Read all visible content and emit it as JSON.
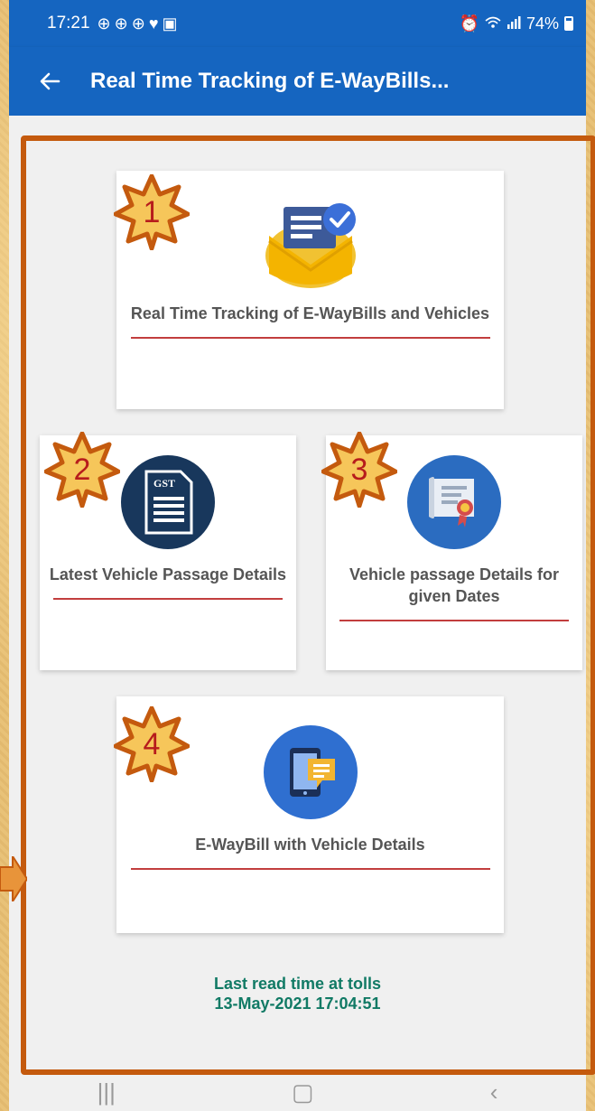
{
  "status_bar": {
    "time": "17:21",
    "battery": "74%",
    "icons": [
      "notification-icon",
      "notification-icon",
      "notification-icon",
      "heart-icon",
      "image-icon"
    ],
    "right_icons": [
      "alarm-icon",
      "wifi-icon",
      "signal-icon",
      "battery-icon"
    ]
  },
  "app_bar": {
    "title": "Real Time Tracking of E-WayBills...",
    "back_icon": "arrow-left-icon"
  },
  "cards": [
    {
      "label": "Real Time Tracking of E-WayBills and Vehicles",
      "badge": "1",
      "icon": "envelope-check-icon"
    },
    {
      "label": "Latest Vehicle Passage Details",
      "badge": "2",
      "icon": "gst-document-icon"
    },
    {
      "label": "Vehicle passage Details for given Dates",
      "badge": "3",
      "icon": "certificate-icon"
    },
    {
      "label": "E-WayBill with Vehicle Details",
      "badge": "4",
      "icon": "tablet-chat-icon"
    }
  ],
  "gst_label": "GST",
  "footer": {
    "line1": "Last read time at tolls",
    "line2": "13-May-2021 17:04:51"
  },
  "colors": {
    "primary": "#1565c0",
    "accent_rule": "#b71c1c",
    "footer_text": "#117a65",
    "highlight_frame": "#c45a0e",
    "badge_fill": "#f6c65a"
  }
}
